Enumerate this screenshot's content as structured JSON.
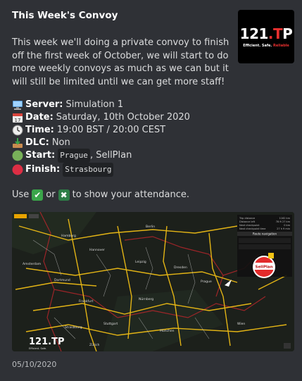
{
  "embed": {
    "title": "This Week's Convoy",
    "description": "This week we'll doing a private convoy to finish off the first week of October, we will start to do more weekly convoys as much as we can but it will still be limited until we can get more staff!",
    "thumbnail": {
      "logo_white": "121",
      "logo_red": ".T",
      "logo_white2": "P",
      "tag_white": "Efficient. Safe. ",
      "tag_red": "Reliable"
    },
    "fields": {
      "server_label": "Server:",
      "server_value": "Simulation 1",
      "date_label": "Date:",
      "date_value": "Saturday, 10th October 2020",
      "time_label": "Time:",
      "time_value": "19:00 BST / 20:00 CEST",
      "dlc_label": "DLC:",
      "dlc_value": "Non",
      "start_label": "Start:",
      "start_city": "Prague",
      "start_company": ", SellPlan",
      "finish_label": "Finish:",
      "finish_city": "Strasbourg"
    },
    "attendance": {
      "pre": "Use",
      "mid": "or",
      "post": "to show your attendance."
    },
    "map": {
      "cities": [
        "Hamburg",
        "Berlin",
        "Amsterdam",
        "Hannover",
        "Dortmund",
        "Leipzig",
        "Dresden",
        "Frankfurt",
        "Prague",
        "Nürnberg",
        "Strasbourg",
        "Stuttgart",
        "München",
        "Wien",
        "Zürich"
      ],
      "panel_title": "Route navigation",
      "panel_rows": [
        "Trip distance",
        "Distance left",
        "Next checkpoint",
        "Next checkpoint time"
      ],
      "panel_values": [
        "1162 km",
        "78 ft 27 km",
        "0 km",
        "27 h 9 min"
      ],
      "marker_label": "SellPlan",
      "badge": "121.TP",
      "badge_sub": "Efficient. Safe."
    },
    "footer": "05/10/2020"
  },
  "colors": {
    "background": "#2f3136",
    "accent_red": "#e8302f",
    "check_green": "#3aa54a",
    "cross_green": "#2d7d46"
  }
}
